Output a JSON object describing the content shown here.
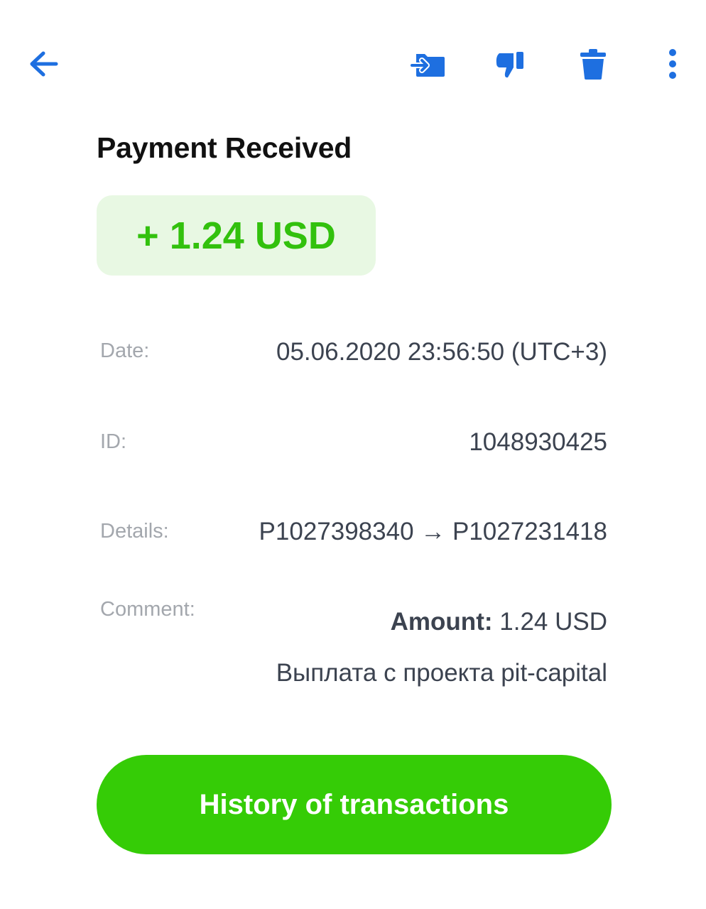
{
  "colors": {
    "accent_blue": "#1e6fe0",
    "success_green": "#32c10d",
    "button_green": "#35cc06",
    "chip_bg": "#e8f8e3",
    "label_gray": "#a3a7ad",
    "value_text": "#3c4350"
  },
  "toolbar": {
    "back_icon": "arrow-left-icon",
    "actions": [
      {
        "icon": "move-to-folder-icon"
      },
      {
        "icon": "thumbs-down-icon"
      },
      {
        "icon": "trash-icon"
      },
      {
        "icon": "more-vertical-icon"
      }
    ]
  },
  "payment": {
    "title": "Payment Received",
    "amount": "+ 1.24 USD"
  },
  "details": {
    "date_label": "Date:",
    "date_value": "05.06.2020 23:56:50 (UTC+3)",
    "id_label": "ID:",
    "id_value": "1048930425",
    "details_label": "Details:",
    "details_value": "P1027398340 → P1027231418",
    "comment_label": "Comment:",
    "comment_amount_label": "Amount:",
    "comment_amount_value": "1.24 USD",
    "comment_text": "Выплата с проекта pit-capital"
  },
  "history_button_label": "History of transactions"
}
